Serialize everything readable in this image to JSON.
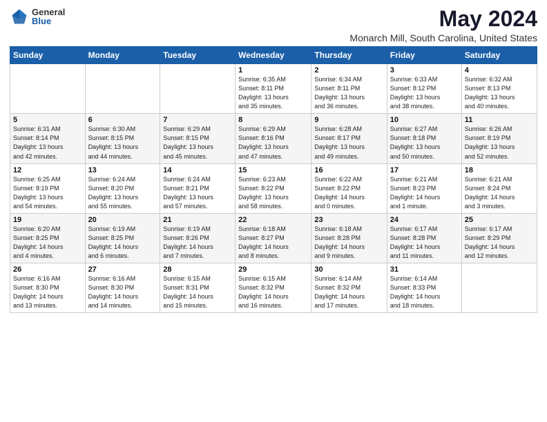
{
  "logo": {
    "general": "General",
    "blue": "Blue"
  },
  "title": "May 2024",
  "subtitle": "Monarch Mill, South Carolina, United States",
  "weekdays": [
    "Sunday",
    "Monday",
    "Tuesday",
    "Wednesday",
    "Thursday",
    "Friday",
    "Saturday"
  ],
  "weeks": [
    [
      {
        "day": "",
        "info": ""
      },
      {
        "day": "",
        "info": ""
      },
      {
        "day": "",
        "info": ""
      },
      {
        "day": "1",
        "info": "Sunrise: 6:35 AM\nSunset: 8:11 PM\nDaylight: 13 hours\nand 35 minutes."
      },
      {
        "day": "2",
        "info": "Sunrise: 6:34 AM\nSunset: 8:11 PM\nDaylight: 13 hours\nand 36 minutes."
      },
      {
        "day": "3",
        "info": "Sunrise: 6:33 AM\nSunset: 8:12 PM\nDaylight: 13 hours\nand 38 minutes."
      },
      {
        "day": "4",
        "info": "Sunrise: 6:32 AM\nSunset: 8:13 PM\nDaylight: 13 hours\nand 40 minutes."
      }
    ],
    [
      {
        "day": "5",
        "info": "Sunrise: 6:31 AM\nSunset: 8:14 PM\nDaylight: 13 hours\nand 42 minutes."
      },
      {
        "day": "6",
        "info": "Sunrise: 6:30 AM\nSunset: 8:15 PM\nDaylight: 13 hours\nand 44 minutes."
      },
      {
        "day": "7",
        "info": "Sunrise: 6:29 AM\nSunset: 8:15 PM\nDaylight: 13 hours\nand 45 minutes."
      },
      {
        "day": "8",
        "info": "Sunrise: 6:29 AM\nSunset: 8:16 PM\nDaylight: 13 hours\nand 47 minutes."
      },
      {
        "day": "9",
        "info": "Sunrise: 6:28 AM\nSunset: 8:17 PM\nDaylight: 13 hours\nand 49 minutes."
      },
      {
        "day": "10",
        "info": "Sunrise: 6:27 AM\nSunset: 8:18 PM\nDaylight: 13 hours\nand 50 minutes."
      },
      {
        "day": "11",
        "info": "Sunrise: 6:26 AM\nSunset: 8:19 PM\nDaylight: 13 hours\nand 52 minutes."
      }
    ],
    [
      {
        "day": "12",
        "info": "Sunrise: 6:25 AM\nSunset: 8:19 PM\nDaylight: 13 hours\nand 54 minutes."
      },
      {
        "day": "13",
        "info": "Sunrise: 6:24 AM\nSunset: 8:20 PM\nDaylight: 13 hours\nand 55 minutes."
      },
      {
        "day": "14",
        "info": "Sunrise: 6:24 AM\nSunset: 8:21 PM\nDaylight: 13 hours\nand 57 minutes."
      },
      {
        "day": "15",
        "info": "Sunrise: 6:23 AM\nSunset: 8:22 PM\nDaylight: 13 hours\nand 58 minutes."
      },
      {
        "day": "16",
        "info": "Sunrise: 6:22 AM\nSunset: 8:22 PM\nDaylight: 14 hours\nand 0 minutes."
      },
      {
        "day": "17",
        "info": "Sunrise: 6:21 AM\nSunset: 8:23 PM\nDaylight: 14 hours\nand 1 minute."
      },
      {
        "day": "18",
        "info": "Sunrise: 6:21 AM\nSunset: 8:24 PM\nDaylight: 14 hours\nand 3 minutes."
      }
    ],
    [
      {
        "day": "19",
        "info": "Sunrise: 6:20 AM\nSunset: 8:25 PM\nDaylight: 14 hours\nand 4 minutes."
      },
      {
        "day": "20",
        "info": "Sunrise: 6:19 AM\nSunset: 8:25 PM\nDaylight: 14 hours\nand 6 minutes."
      },
      {
        "day": "21",
        "info": "Sunrise: 6:19 AM\nSunset: 8:26 PM\nDaylight: 14 hours\nand 7 minutes."
      },
      {
        "day": "22",
        "info": "Sunrise: 6:18 AM\nSunset: 8:27 PM\nDaylight: 14 hours\nand 8 minutes."
      },
      {
        "day": "23",
        "info": "Sunrise: 6:18 AM\nSunset: 8:28 PM\nDaylight: 14 hours\nand 9 minutes."
      },
      {
        "day": "24",
        "info": "Sunrise: 6:17 AM\nSunset: 8:28 PM\nDaylight: 14 hours\nand 11 minutes."
      },
      {
        "day": "25",
        "info": "Sunrise: 6:17 AM\nSunset: 8:29 PM\nDaylight: 14 hours\nand 12 minutes."
      }
    ],
    [
      {
        "day": "26",
        "info": "Sunrise: 6:16 AM\nSunset: 8:30 PM\nDaylight: 14 hours\nand 13 minutes."
      },
      {
        "day": "27",
        "info": "Sunrise: 6:16 AM\nSunset: 8:30 PM\nDaylight: 14 hours\nand 14 minutes."
      },
      {
        "day": "28",
        "info": "Sunrise: 6:15 AM\nSunset: 8:31 PM\nDaylight: 14 hours\nand 15 minutes."
      },
      {
        "day": "29",
        "info": "Sunrise: 6:15 AM\nSunset: 8:32 PM\nDaylight: 14 hours\nand 16 minutes."
      },
      {
        "day": "30",
        "info": "Sunrise: 6:14 AM\nSunset: 8:32 PM\nDaylight: 14 hours\nand 17 minutes."
      },
      {
        "day": "31",
        "info": "Sunrise: 6:14 AM\nSunset: 8:33 PM\nDaylight: 14 hours\nand 18 minutes."
      },
      {
        "day": "",
        "info": ""
      }
    ]
  ]
}
